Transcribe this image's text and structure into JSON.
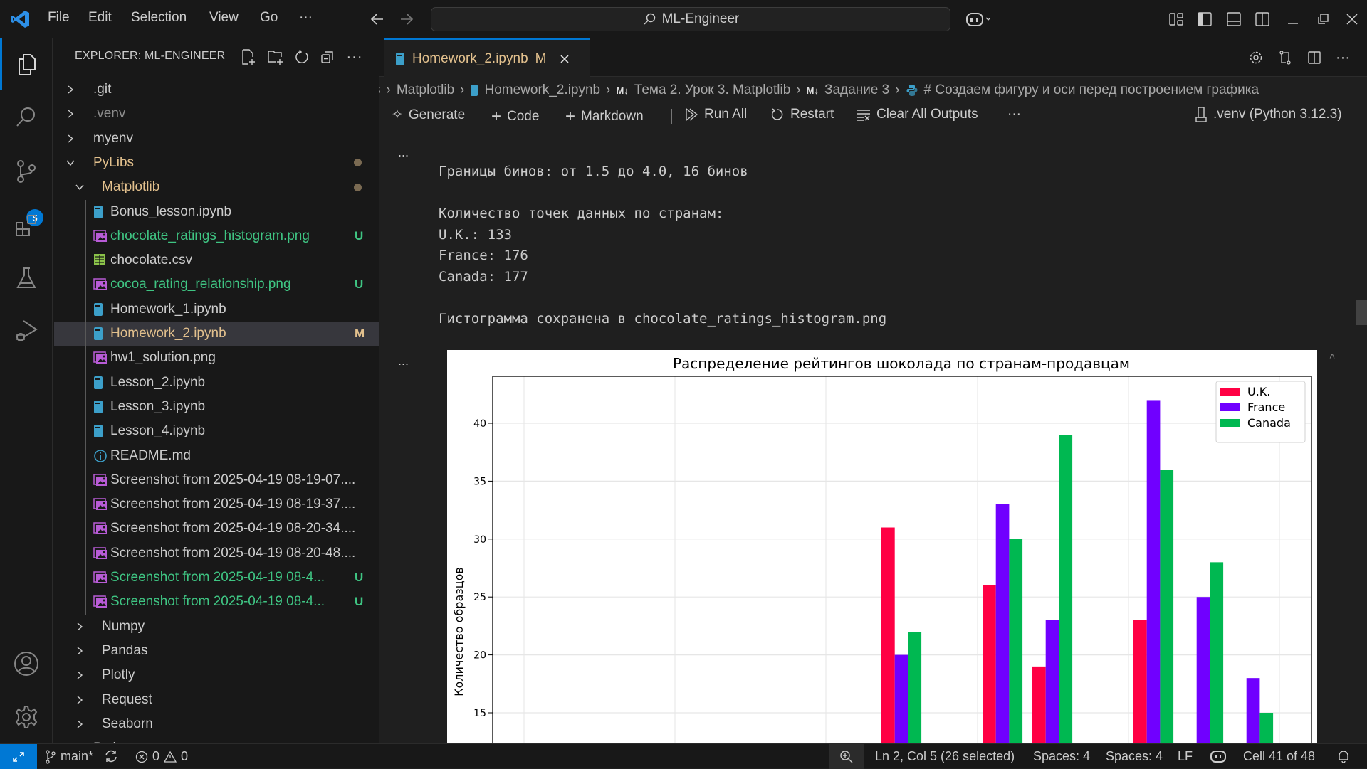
{
  "titlebar": {
    "menus": [
      "File",
      "Edit",
      "Selection",
      "View",
      "Go",
      "···"
    ],
    "search_text": "ML-Engineer"
  },
  "activity_bar": {
    "source_control_badge": "5"
  },
  "explorer": {
    "title": "EXPLORER: ML-ENGINEER",
    "items": [
      {
        "label": ".git",
        "level": 0,
        "kind": "folder-closed",
        "color": "#cccccc"
      },
      {
        "label": ".venv",
        "level": 0,
        "kind": "folder-closed",
        "color": "#8c8c8c"
      },
      {
        "label": "myenv",
        "level": 0,
        "kind": "folder-closed",
        "color": "#cccccc"
      },
      {
        "label": "PyLibs",
        "level": 0,
        "kind": "folder-open",
        "color": "#e2c08d",
        "dot": true
      },
      {
        "label": "Matplotlib",
        "level": 1,
        "kind": "folder-open",
        "color": "#e2c08d",
        "dot": true
      },
      {
        "label": "Bonus_lesson.ipynb",
        "level": 2,
        "kind": "notebook",
        "color": "#cccccc"
      },
      {
        "label": "chocolate_ratings_histogram.png",
        "level": 2,
        "kind": "image",
        "color": "#3fc583",
        "status": "U"
      },
      {
        "label": "chocolate.csv",
        "level": 2,
        "kind": "csv",
        "color": "#cccccc"
      },
      {
        "label": "cocoa_rating_relationship.png",
        "level": 2,
        "kind": "image",
        "color": "#3fc583",
        "status": "U"
      },
      {
        "label": "Homework_1.ipynb",
        "level": 2,
        "kind": "notebook",
        "color": "#cccccc"
      },
      {
        "label": "Homework_2.ipynb",
        "level": 2,
        "kind": "notebook",
        "color": "#e2c08d",
        "status": "M",
        "selected": true
      },
      {
        "label": "hw1_solution.png",
        "level": 2,
        "kind": "image",
        "color": "#cccccc"
      },
      {
        "label": "Lesson_2.ipynb",
        "level": 2,
        "kind": "notebook",
        "color": "#cccccc"
      },
      {
        "label": "Lesson_3.ipynb",
        "level": 2,
        "kind": "notebook",
        "color": "#cccccc"
      },
      {
        "label": "Lesson_4.ipynb",
        "level": 2,
        "kind": "notebook",
        "color": "#cccccc"
      },
      {
        "label": "README.md",
        "level": 2,
        "kind": "info",
        "color": "#cccccc"
      },
      {
        "label": "Screenshot from 2025-04-19 08-19-07....",
        "level": 2,
        "kind": "image",
        "color": "#cccccc"
      },
      {
        "label": "Screenshot from 2025-04-19 08-19-37....",
        "level": 2,
        "kind": "image",
        "color": "#cccccc"
      },
      {
        "label": "Screenshot from 2025-04-19 08-20-34....",
        "level": 2,
        "kind": "image",
        "color": "#cccccc"
      },
      {
        "label": "Screenshot from 2025-04-19 08-20-48....",
        "level": 2,
        "kind": "image",
        "color": "#cccccc"
      },
      {
        "label": "Screenshot from 2025-04-19 08-4...",
        "level": 2,
        "kind": "image",
        "color": "#3fc583",
        "status": "U"
      },
      {
        "label": "Screenshot from 2025-04-19 08-4...",
        "level": 2,
        "kind": "image",
        "color": "#3fc583",
        "status": "U"
      },
      {
        "label": "Numpy",
        "level": 1,
        "kind": "folder-closed",
        "color": "#cccccc"
      },
      {
        "label": "Pandas",
        "level": 1,
        "kind": "folder-closed",
        "color": "#cccccc"
      },
      {
        "label": "Plotly",
        "level": 1,
        "kind": "folder-closed",
        "color": "#cccccc"
      },
      {
        "label": "Request",
        "level": 1,
        "kind": "folder-closed",
        "color": "#cccccc"
      },
      {
        "label": "Seaborn",
        "level": 1,
        "kind": "folder-closed",
        "color": "#cccccc"
      },
      {
        "label": "Python",
        "level": 0,
        "kind": "folder-closed",
        "color": "#cccccc"
      }
    ]
  },
  "tab": {
    "label": "Homework_2.ipynb",
    "status": "M"
  },
  "breadcrumb": [
    "s",
    "Matplotlib",
    "Homework_2.ipynb",
    "Тема 2. Урок 3. Matplotlib",
    "Задание 3",
    "# Создаем фигуру и оси перед построением графика"
  ],
  "toolbar": {
    "generate": "Generate",
    "code": "Code",
    "markdown": "Markdown",
    "run_all": "Run All",
    "restart": "Restart",
    "clear_outputs": "Clear All Outputs",
    "more": "···",
    "kernel": ".venv (Python 3.12.3)"
  },
  "output": {
    "lines": [
      "Границы бинов: от 1.5 до 4.0, 16 бинов",
      "",
      "Количество точек данных по странам:",
      "U.K.: 133",
      "France: 176",
      "Canada: 177",
      "",
      "Гистограмма сохранена в chocolate_ratings_histogram.png"
    ],
    "cell_more": "..."
  },
  "chart_data": {
    "type": "bar",
    "title": "Распределение рейтингов шоколада по странам-продавцам",
    "xlabel": "",
    "ylabel": "Количество образцов",
    "ylim": [
      12.4,
      44
    ],
    "yticks": [
      "15",
      "20",
      "25",
      "30",
      "35",
      "40"
    ],
    "grid": true,
    "legend": "top-right",
    "series": [
      {
        "name": "U.K.",
        "color": "#ff0044",
        "values": [
          31,
          26,
          19,
          23,
          null,
          null
        ]
      },
      {
        "name": "France",
        "color": "#7000ff",
        "values": [
          20,
          33,
          23,
          42,
          25,
          18
        ]
      },
      {
        "name": "Canada",
        "color": "#00b851",
        "values": [
          22,
          30,
          39,
          36,
          28,
          15
        ]
      }
    ]
  },
  "statusbar": {
    "branch": "main*",
    "errors": "0",
    "warnings": "0",
    "position": "Ln 2, Col 5 (26 selected)",
    "spaces1": "Spaces: 4",
    "spaces2": "Spaces: 4",
    "eol": "LF",
    "cell": "Cell 41 of 48"
  },
  "colors": {
    "accent": "#0078d4",
    "untracked": "#3fc583",
    "modified": "#e2c08d"
  }
}
